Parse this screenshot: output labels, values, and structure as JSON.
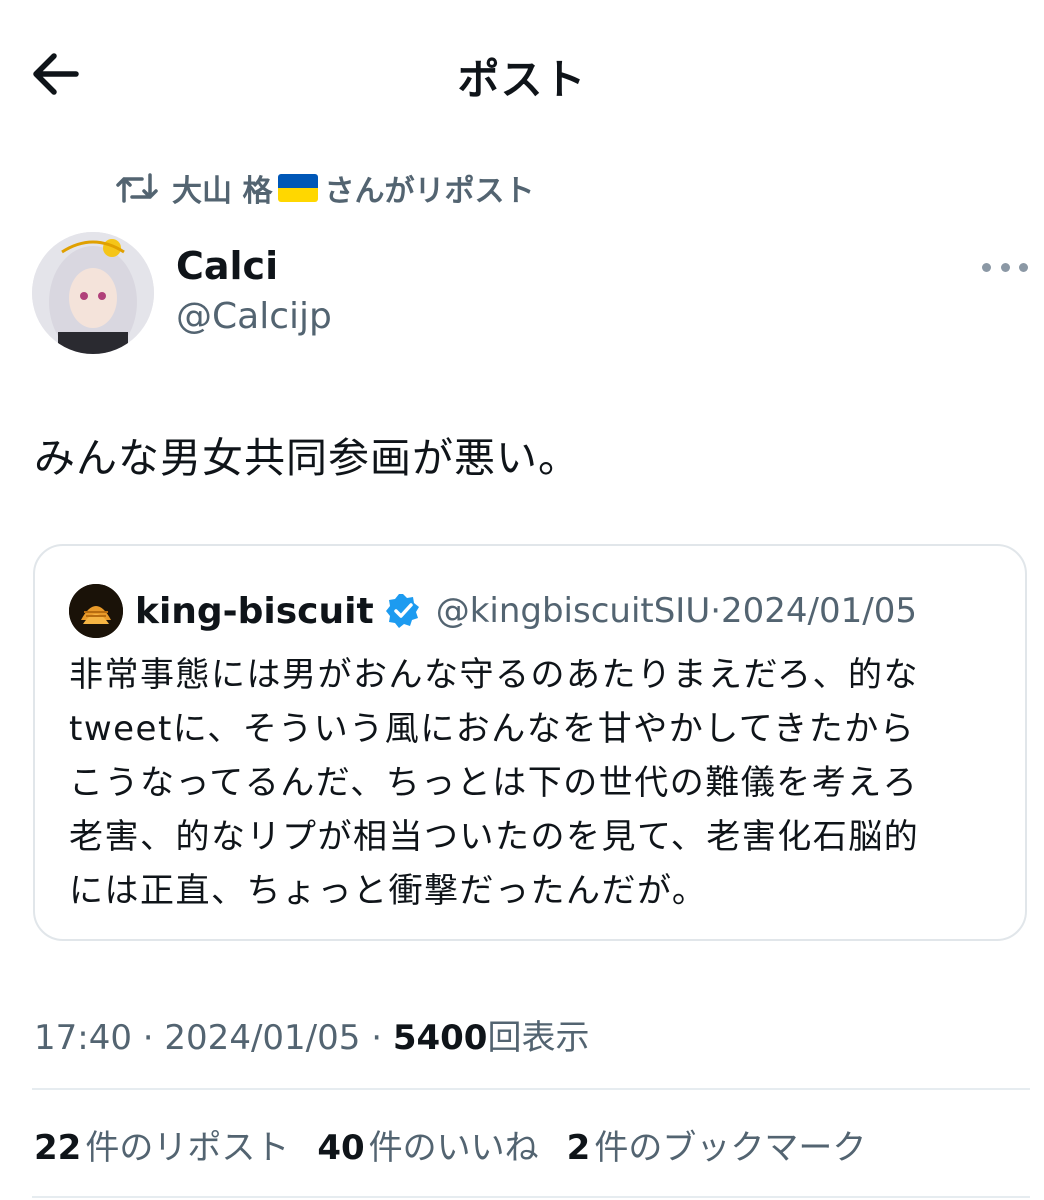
{
  "header": {
    "title": "ポスト",
    "back_icon": "arrow-left-icon"
  },
  "repost": {
    "user": "大山 格",
    "suffix": "さんがリポスト",
    "icon": "retweet-icon",
    "flag": "ukraine-flag"
  },
  "post": {
    "author_name": "Calci",
    "author_handle": "@Calcijp",
    "text": "みんな男女共同参画が悪い。",
    "time": "17:40",
    "date": "2024/01/05",
    "views": "5400",
    "views_label": "回表示",
    "separator": " · "
  },
  "quote": {
    "author_name": "king-biscuit",
    "author_handle": "@kingbiscuitSIU",
    "separator": " · ",
    "date": "2024/01/05",
    "verified": true,
    "lines": [
      "非常事態には男がおんな守るのあたりまえだろ、的な",
      "tweetに、そういう風におんなを甘やかしてきたから",
      "こうなってるんだ、ちっとは下の世代の難儀を考えろ",
      "老害、的なリプが相当ついたのを見て、老害化石脳的",
      "には正直、ちょっと衝撃だったんだが。"
    ]
  },
  "stats": {
    "reposts_count": "22",
    "reposts_label": "件のリポスト",
    "likes_count": "40",
    "likes_label": "件のいいね",
    "bookmarks_count": "2",
    "bookmarks_label": "件のブックマーク"
  },
  "colors": {
    "text": "#0f1419",
    "secondary": "#536471",
    "verified": "#1d9bf0",
    "border": "#e1e6ea"
  }
}
